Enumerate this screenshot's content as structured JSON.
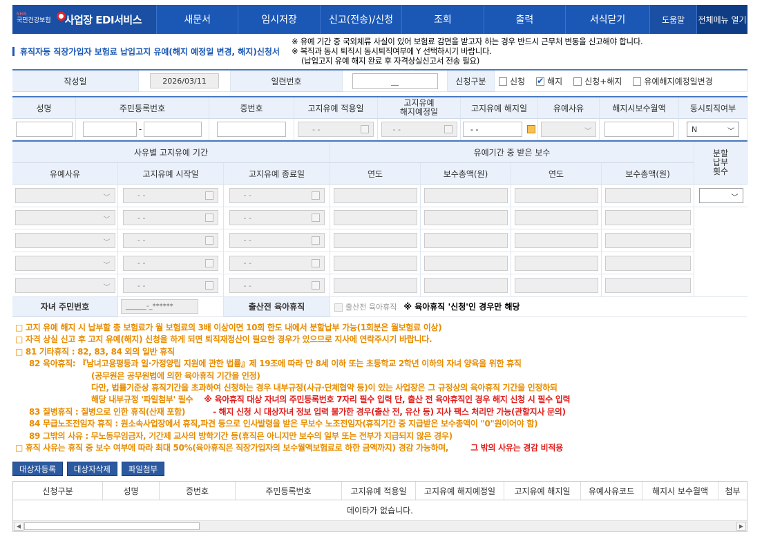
{
  "nav": {
    "org_small": "국민건강보험",
    "org_tiny": "NHIS",
    "title": "사업장 EDI서비스",
    "items": [
      "새문서",
      "임시저장",
      "신고(전송)/신청",
      "조회",
      "출력",
      "서식닫기"
    ],
    "help": "도움말",
    "menu": "전체메뉴 열기"
  },
  "heading": "휴직자등 직장가입자 보험료 납입고지 유예(해지 예정일 변경, 해지)신청서",
  "notices": [
    "※ 유예 기간 중 국외체류 사실이 있어 보험료 감면을 받고자 하는 경우 반드시 근무처 변동을 신고해야 합니다.",
    "※ 복직과 동시 퇴직시 동시퇴직여부에 Y 선택하시기 바랍니다.",
    "(납입고지 유예 해지 완료 후 자격상실신고서 전송 필요)"
  ],
  "form_top": {
    "date_label": "작성일",
    "date_value": "2026/03/11",
    "serial_label": "일련번호",
    "serial_value": "__",
    "type_label": "신청구분",
    "options": [
      {
        "label": "신청",
        "checked": false
      },
      {
        "label": "해지",
        "checked": true
      },
      {
        "label": "신청+해지",
        "checked": false
      },
      {
        "label": "유예해지예정일변경",
        "checked": false
      }
    ]
  },
  "person": {
    "headers": [
      "성명",
      "주민등록번호",
      "증번호",
      "고지유예 적용일",
      "고지유예\n해지예정일",
      "고지유예 해지일",
      "유예사유",
      "해지시보수월액",
      "동시퇴직여부"
    ],
    "date_placeholder": "- -",
    "rrn_sep": "-",
    "retire_value": "N"
  },
  "period": {
    "group1": "사유별 고지유예 기간",
    "group2": "유예기간 중 받은 보수",
    "split_label": "분할\n납부\n횟수",
    "cols": [
      "유예사유",
      "고지유예 시작일",
      "고지유예 종료일",
      "연도",
      "보수총액(원)",
      "연도",
      "보수총액(원)"
    ],
    "date_placeholder": "- -",
    "row_count": 5
  },
  "child": {
    "label": "자녀 주민번호",
    "placeholder": "______-_******",
    "leave_label": "출산전 육아휴직",
    "checkbox_label": "출산전 육아휴직",
    "note": "※ 육아휴직 '신청'인 경우만 해당"
  },
  "notes": {
    "l1": "□ 고지 유예 해지 시 납부할 총 보험료가 월 보험료의 3배 이상이면 10회 한도 내에서 분할납부 가능(1회분은 월보험료 이상)",
    "l2": "□ 자격 상실 신고 후 고지 유예(해지) 신청을 하게 되면 퇴직재정산이 필요한 경우가 있으므로 지사에 연락주시기 바랍니다.",
    "l3": "□ 81 기타휴직 : 82, 83, 84 외의 일반 휴직",
    "l4": "82 육아휴직: 『남녀고용평등과 일·가정양립 지원에 관한 법률』제 19조에 따라 만 8세 이하 또는 초등학교 2학년 이하의 자녀 양육을 위한 휴직",
    "l5": "(공무원은 공무원법에 의한 육아휴직 기간을 인정)",
    "l6": "다만, 법률기준상 휴직기간을 초과하여 신청하는 경우 내부규정(사규·단체협약 등)이 있는 사업장은 그 규정상의 육아휴직 기간을 인정하되",
    "l7a": "해당 내부규정 '파일첨부' 필수",
    "l7b": "※ 육아휴직 대상 자녀의 주민등록번호 7자리 필수 입력 단, 출산 전 육아휴직인 경우 해지 신청 시 필수 입력",
    "l8a": "83 질병휴직 : 질병으로 인한 휴직(산재 포함)",
    "l8b": "- 해지 신청 시 대상자녀 정보 입력 불가한 경우(출산 전, 유산 등) 지사 팩스 처리만 가능(관할지사 문의)",
    "l9": "84 무급노조전임자 휴직 : 원소속사업장에서 휴직,파견 등으로 인사발령을 받은 무보수 노조전임자(휴직기간 중 지급받은 보수총액이 \"0\"원이어야 함)",
    "l10": "89 그밖의 사유 : 무노동무임금자, 기간제 교사의 방학기간 등(휴직은 아니지만 보수의 일부 또는 전부가 지급되지 않은 경우)",
    "l11a": "□ 휴직 사유는 휴직 중 보수 여부에 따라 최대 50%(육아휴직은 직장가입자의 보수월액보험료로 하한 금액까지) 경감 가능하며,",
    "l11b": "그 밖의 사유는 경감 비적용"
  },
  "buttons": [
    "대상자등록",
    "대상자삭제",
    "파일첨부"
  ],
  "grid": {
    "headers": [
      "신청구분",
      "성명",
      "증번호",
      "주민등록번호",
      "고지유예 적용일",
      "고지유예 해지예정일",
      "고지유예 해지일",
      "유예사유코드",
      "해지시 보수월액",
      "첨부"
    ],
    "empty": "데이타가 없습니다."
  }
}
